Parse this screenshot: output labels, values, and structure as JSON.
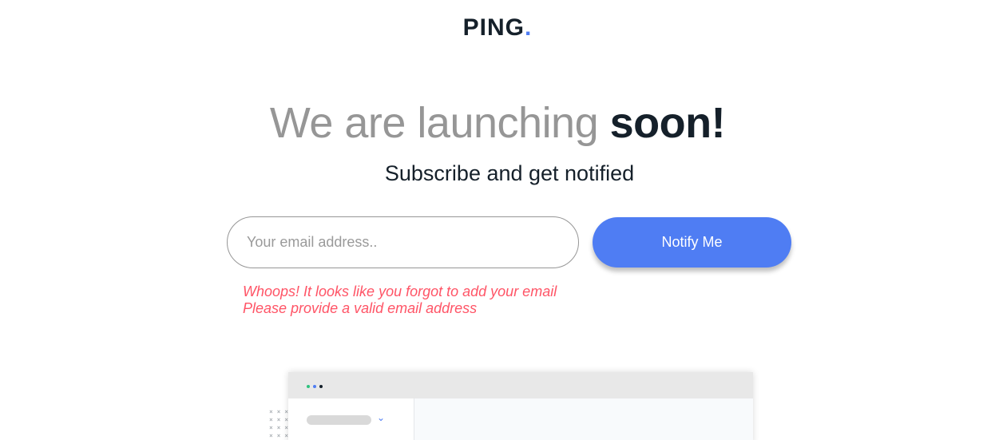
{
  "logo": {
    "text": "PING",
    "dot": "."
  },
  "headline": {
    "light": "We are launching ",
    "strong": "soon!"
  },
  "subline": "Subscribe and get notified",
  "form": {
    "email_placeholder": "Your email address..",
    "email_value": "",
    "button_label": "Notify Me"
  },
  "errors": [
    "Whoops! It looks like you forgot to add your email",
    "Please provide a valid email address"
  ],
  "colors": {
    "brand_blue": "#4f7df3",
    "dark_text": "#15202a",
    "gray_text": "#969696",
    "error_red": "#ff5466"
  },
  "illustration": {
    "window_dots": [
      "#2ec27e",
      "#4f7df3",
      "#15202a"
    ],
    "chevron_icon": "chevron-down-icon",
    "pattern": "× × ×\n× × ×\n× × ×\n× × ×"
  }
}
